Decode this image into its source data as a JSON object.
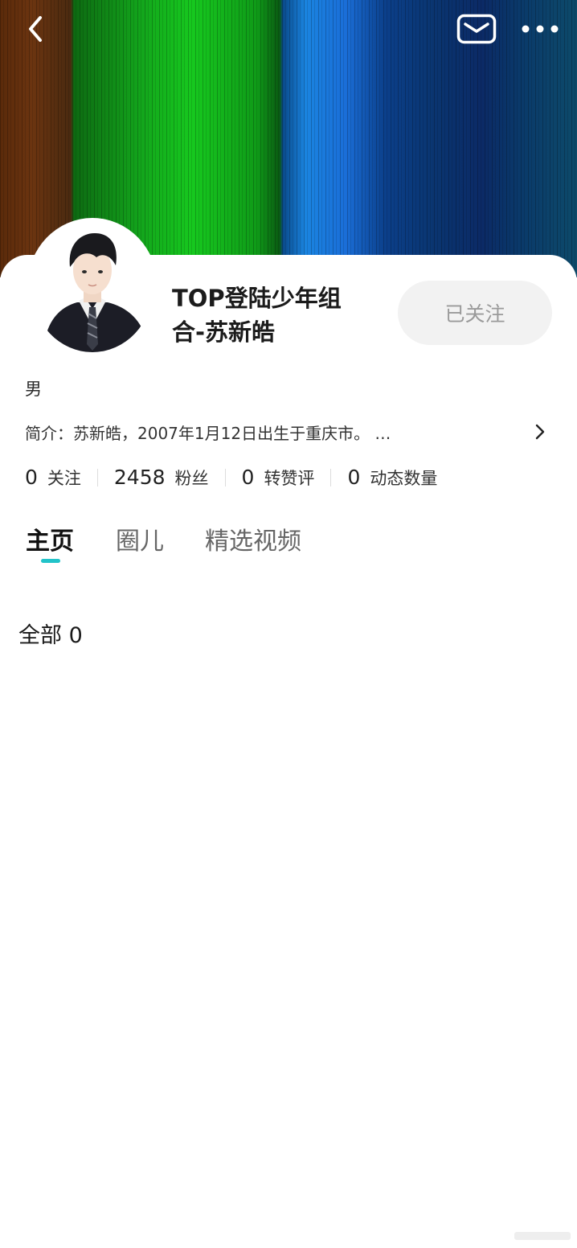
{
  "header": {
    "back_icon": "chevron-left-icon",
    "mail_icon": "envelope-icon",
    "more_icon": "ellipsis-icon"
  },
  "profile": {
    "nickname_line1": "TOP登陆少年组",
    "nickname_line2": "合-苏新皓",
    "follow_label": "已关注",
    "gender": "男",
    "intro": "简介：苏新皓，2007年1月12日出生于重庆市。 …"
  },
  "stats": [
    {
      "value": "0",
      "label": "关注"
    },
    {
      "value": "2458",
      "label": "粉丝"
    },
    {
      "value": "0",
      "label": "转赞评"
    },
    {
      "value": "0",
      "label": "动态数量"
    }
  ],
  "tabs": [
    {
      "label": "主页"
    },
    {
      "label": "圈儿"
    },
    {
      "label": "精选视频"
    }
  ],
  "section": {
    "label": "全部 0"
  },
  "colors": {
    "accent": "#22c3c9",
    "follow_bg": "#f2f2f2",
    "follow_text": "#9a9a9a"
  }
}
